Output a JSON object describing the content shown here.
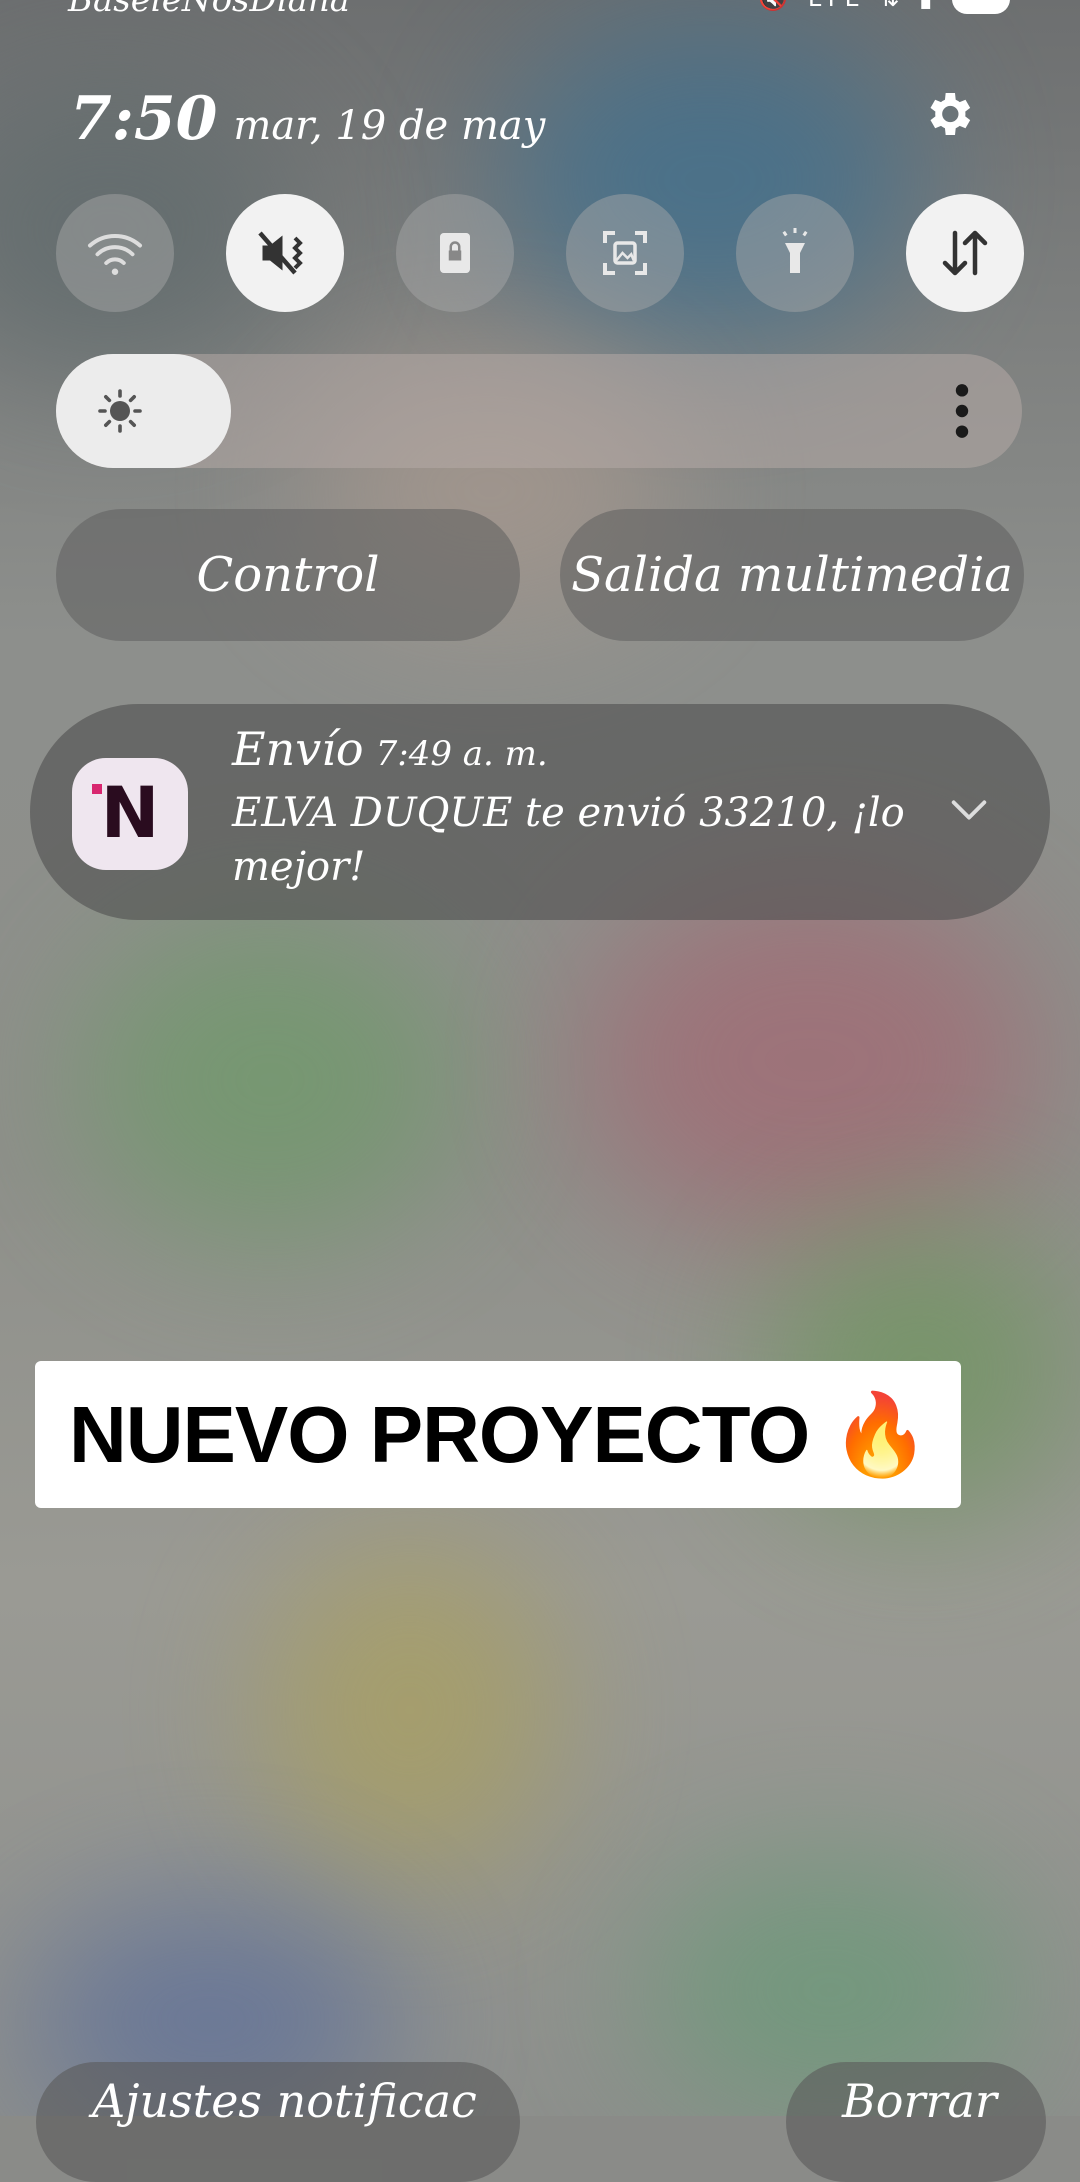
{
  "status_bar": {
    "carrier": "BaseleNosDiana",
    "icons": [
      "mute-icon",
      "lte-icon",
      "data-arrows-icon",
      "signal-icon",
      "battery-icon"
    ],
    "lte_label": "LTE"
  },
  "header": {
    "time": "7:50",
    "date": "mar, 19 de may"
  },
  "quick_settings": [
    {
      "name": "wifi",
      "icon": "wifi-icon",
      "active": false
    },
    {
      "name": "sound",
      "icon": "mute-vibrate-icon",
      "active": true
    },
    {
      "name": "screen-lock",
      "icon": "lock-icon",
      "active": false
    },
    {
      "name": "screenshot",
      "icon": "screenshot-icon",
      "active": false
    },
    {
      "name": "flashlight",
      "icon": "flashlight-icon",
      "active": false
    },
    {
      "name": "mobile-data",
      "icon": "data-arrows-icon",
      "active": true
    }
  ],
  "brightness": {
    "level": 0.14,
    "icon": "sun-icon",
    "menu_icon": "more-vertical-icon"
  },
  "buttons": {
    "control": "Control",
    "media_output": "Salida multimedia"
  },
  "notification": {
    "app_name": "Envío",
    "app_icon_letter": "N",
    "time": "7:49 a. m.",
    "body": "ELVA DUQUE te envió 33210, ¡lo mejor!"
  },
  "overlay": {
    "text": "NUEVO PROYECTO 🔥"
  },
  "bottom": {
    "notif_settings": "Ajustes notificac",
    "clear": "Borrar"
  },
  "colors": {
    "tile_active": "#f2f2f2",
    "app_icon_bg": "#efe6ef",
    "app_icon_accent": "#d8266f"
  }
}
